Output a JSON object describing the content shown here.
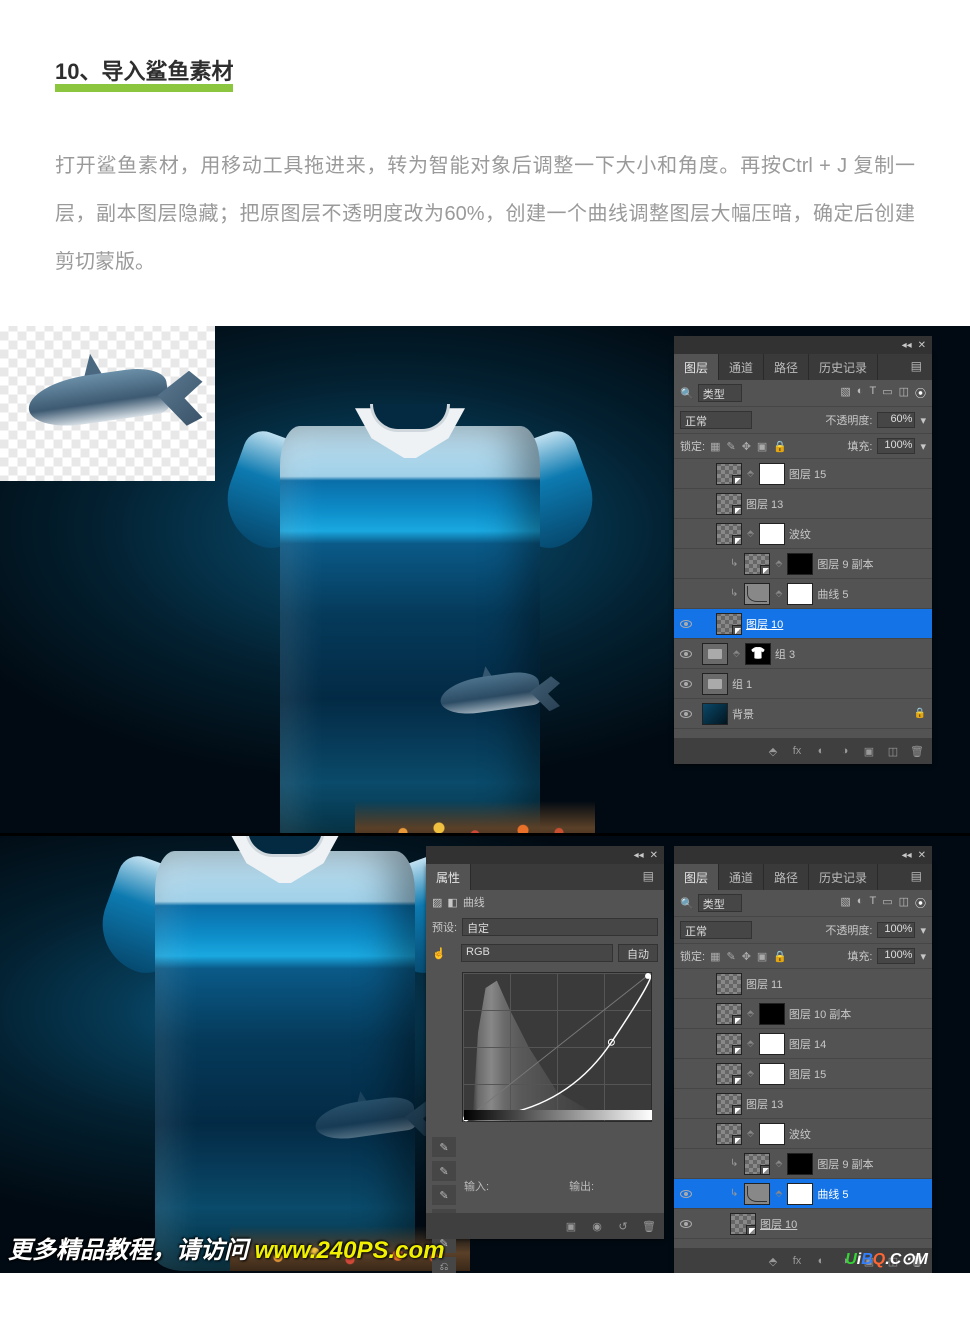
{
  "article": {
    "step_number": "10、导入鲨鱼素材",
    "body": "打开鲨鱼素材，用移动工具拖进来，转为智能对象后调整一下大小和角度。再按Ctrl + J 复制一层，副本图层隐藏；把原图层不透明度改为60%，创建一个曲线调整图层大幅压暗，确定后创建剪切蒙版。"
  },
  "upper_panel": {
    "tabs": {
      "layers": "图层",
      "channels": "通道",
      "paths": "路径",
      "history": "历史记录"
    },
    "filter_label": "类型",
    "blend_mode": "正常",
    "opacity_label": "不透明度:",
    "opacity_value": "60%",
    "lock_label": "锁定:",
    "fill_label": "填充:",
    "fill_value": "100%",
    "layers": [
      {
        "name": "图层 15",
        "visible": false,
        "indent": 1,
        "thumbs": [
          "smart",
          "white-mask"
        ]
      },
      {
        "name": "图层 13",
        "visible": false,
        "indent": 1,
        "thumbs": [
          "smart"
        ]
      },
      {
        "name": "波纹",
        "visible": false,
        "indent": 1,
        "thumbs": [
          "smart",
          "white-mask"
        ]
      },
      {
        "name": "图层 9 副本",
        "visible": false,
        "indent": 2,
        "clip": true,
        "thumbs": [
          "smart",
          "black-mask"
        ]
      },
      {
        "name": "曲线 5",
        "visible": false,
        "indent": 2,
        "clip": true,
        "thumbs": [
          "curve",
          "white-mask"
        ]
      },
      {
        "name": "图层 10",
        "visible": true,
        "indent": 1,
        "selected": true,
        "thumbs": [
          "smart"
        ],
        "underline": true
      },
      {
        "name": "组 3",
        "visible": true,
        "indent": 0,
        "thumbs": [
          "folder",
          "tshirt-icon"
        ]
      },
      {
        "name": "组 1",
        "visible": true,
        "indent": 0,
        "thumbs": [
          "folder"
        ]
      },
      {
        "name": "背景",
        "visible": true,
        "indent": 0,
        "thumbs": [
          "grad"
        ],
        "locked": true
      }
    ],
    "footer_fx": "fx"
  },
  "lower_layers": {
    "tabs": {
      "layers": "图层",
      "channels": "通道",
      "paths": "路径",
      "history": "历史记录"
    },
    "filter_label": "类型",
    "blend_mode": "正常",
    "opacity_label": "不透明度:",
    "opacity_value": "100%",
    "lock_label": "锁定:",
    "fill_label": "填充:",
    "fill_value": "100%",
    "layers": [
      {
        "name": "图层 11",
        "visible": false,
        "indent": 1,
        "thumbs": [
          "checker"
        ]
      },
      {
        "name": "图层 10 副本",
        "visible": false,
        "indent": 1,
        "thumbs": [
          "smart",
          "black-mask"
        ]
      },
      {
        "name": "图层 14",
        "visible": false,
        "indent": 1,
        "thumbs": [
          "smart",
          "white-mask"
        ]
      },
      {
        "name": "图层 15",
        "visible": false,
        "indent": 1,
        "thumbs": [
          "smart",
          "white-mask"
        ]
      },
      {
        "name": "图层 13",
        "visible": false,
        "indent": 1,
        "thumbs": [
          "smart"
        ]
      },
      {
        "name": "波纹",
        "visible": false,
        "indent": 1,
        "thumbs": [
          "smart",
          "white-mask"
        ]
      },
      {
        "name": "图层 9 副本",
        "visible": false,
        "indent": 2,
        "clip": true,
        "thumbs": [
          "smart",
          "black-mask"
        ]
      },
      {
        "name": "曲线 5",
        "visible": true,
        "indent": 2,
        "clip": true,
        "selected": true,
        "thumbs": [
          "curve",
          "white-mask"
        ]
      },
      {
        "name": "图层 10",
        "visible": true,
        "indent": 2,
        "thumbs": [
          "smart"
        ],
        "underline": true
      }
    ]
  },
  "props_panel": {
    "tab": "属性",
    "type_label": "曲线",
    "preset_label": "预设:",
    "preset_value": "自定",
    "channel_value": "RGB",
    "auto_btn": "自动",
    "input_label": "输入:",
    "output_label": "输出:"
  },
  "watermark": {
    "line1_pre": "更多精品教程，请访问 ",
    "line1_domain": "www.240PS.com",
    "brand_u": "U",
    "brand_i": "i",
    "brand_b": "B",
    "brand_q": "Q",
    "brand_dot": ".",
    "brand_c": "C",
    "brand_n": "⊙M"
  }
}
